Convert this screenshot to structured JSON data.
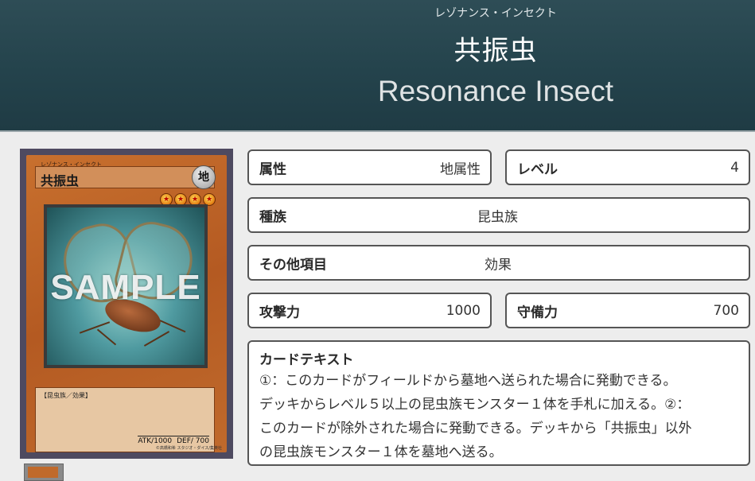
{
  "header": {
    "ruby": "レゾナンス・インセクト",
    "name_ja": "共振虫",
    "name_en": "Resonance Insect"
  },
  "card_image": {
    "ruby": "レゾナンス・インセクト",
    "name": "共振虫",
    "attribute_glyph": "地",
    "level_stars": 4,
    "watermark": "SAMPLE",
    "type_line": "【昆虫族／効果】",
    "atk_text": "ATK/1000",
    "def_text": "DEF/ 700",
    "copyright": "©高橋和希 スタジオ・ダイス/集英社"
  },
  "attribute": {
    "label": "属性",
    "value": "地属性"
  },
  "level": {
    "label": "レベル",
    "value": "4"
  },
  "type": {
    "label": "種族",
    "value": "昆虫族"
  },
  "other": {
    "label": "その他項目",
    "value": "効果"
  },
  "atk": {
    "label": "攻撃力",
    "value": "1000"
  },
  "def": {
    "label": "守備力",
    "value": "700"
  },
  "card_text": {
    "label": "カードテキスト",
    "lines": [
      "①：このカードがフィールドから墓地へ送られた場合に発動できる。",
      "デッキからレベル５以上の昆虫族モンスター１体を手札に加える。②：",
      "このカードが除外された場合に発動できる。デッキから「共振虫」以外",
      "の昆虫族モンスター１体を墓地へ送る。"
    ]
  },
  "colors": {
    "header_bg": "#24434c",
    "page_bg": "#ededed",
    "box_border": "#555555",
    "card_frame": "#c06a2c"
  },
  "icons": {
    "attribute": "earth-attribute-icon",
    "level_star": "level-star-icon"
  }
}
